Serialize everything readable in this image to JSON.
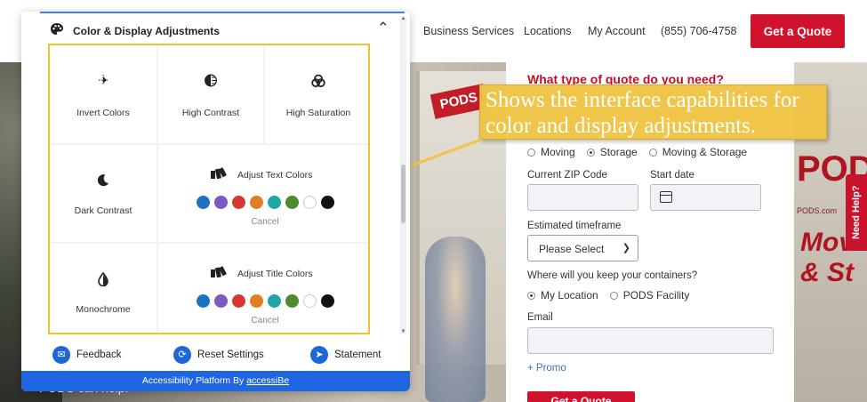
{
  "site": {
    "nav": [
      "Business Services",
      "Locations",
      "My Account",
      "(855) 706-4758"
    ],
    "quote_button": "Get a Quote",
    "need_help": "Need Help?",
    "hero_caption": "PODS can help.",
    "truck_logo": "PODS",
    "truck_text_right": "POD",
    "truck_url": "PODS.com",
    "truck_slogan": "Moving & St"
  },
  "form": {
    "title": "What type of quote do you need?",
    "service_options": [
      {
        "label": "Moving",
        "selected": false
      },
      {
        "label": "Storage",
        "selected": true
      },
      {
        "label": "Moving & Storage",
        "selected": false
      }
    ],
    "zip_label": "Current ZIP Code",
    "zip_value": "",
    "start_label": "Start date",
    "timeframe_label": "Estimated timeframe",
    "timeframe_value": "Please Select",
    "keep_label": "Where will you keep your containers?",
    "keep_options": [
      {
        "label": "My Location",
        "selected": true
      },
      {
        "label": "PODS Facility",
        "selected": false
      }
    ],
    "email_label": "Email",
    "email_value": "",
    "promo": "+ Promo",
    "submit": "Get a Quote"
  },
  "callout": {
    "text": "Shows the interface capabilities for color and display adjustments.",
    "color": "#efc545"
  },
  "panel": {
    "section_title": "Color & Display Adjustments",
    "tiles": [
      {
        "label": "Invert Colors",
        "icon": "invert-colors-icon"
      },
      {
        "label": "High Contrast",
        "icon": "high-contrast-icon"
      },
      {
        "label": "High Saturation",
        "icon": "high-saturation-icon"
      },
      {
        "label": "Dark Contrast",
        "icon": "moon-icon"
      },
      {
        "label": "Monochrome",
        "icon": "droplet-icon"
      }
    ],
    "adjust_text": {
      "label": "Adjust Text Colors",
      "cancel": "Cancel"
    },
    "adjust_title": {
      "label": "Adjust Title Colors",
      "cancel": "Cancel"
    },
    "swatch_colors": [
      "#1e73be",
      "#7b5bbf",
      "#d33a32",
      "#e17e24",
      "#1fa5a5",
      "#4e8b2f",
      "#ffffff",
      "#111111"
    ],
    "footer": {
      "feedback": "Feedback",
      "reset": "Reset Settings",
      "statement": "Statement"
    },
    "platform_prefix": "Accessibility Platform By ",
    "platform_link": "accessiBe",
    "accent_color": "#1f66e0",
    "highlight_color": "#f3c034"
  }
}
